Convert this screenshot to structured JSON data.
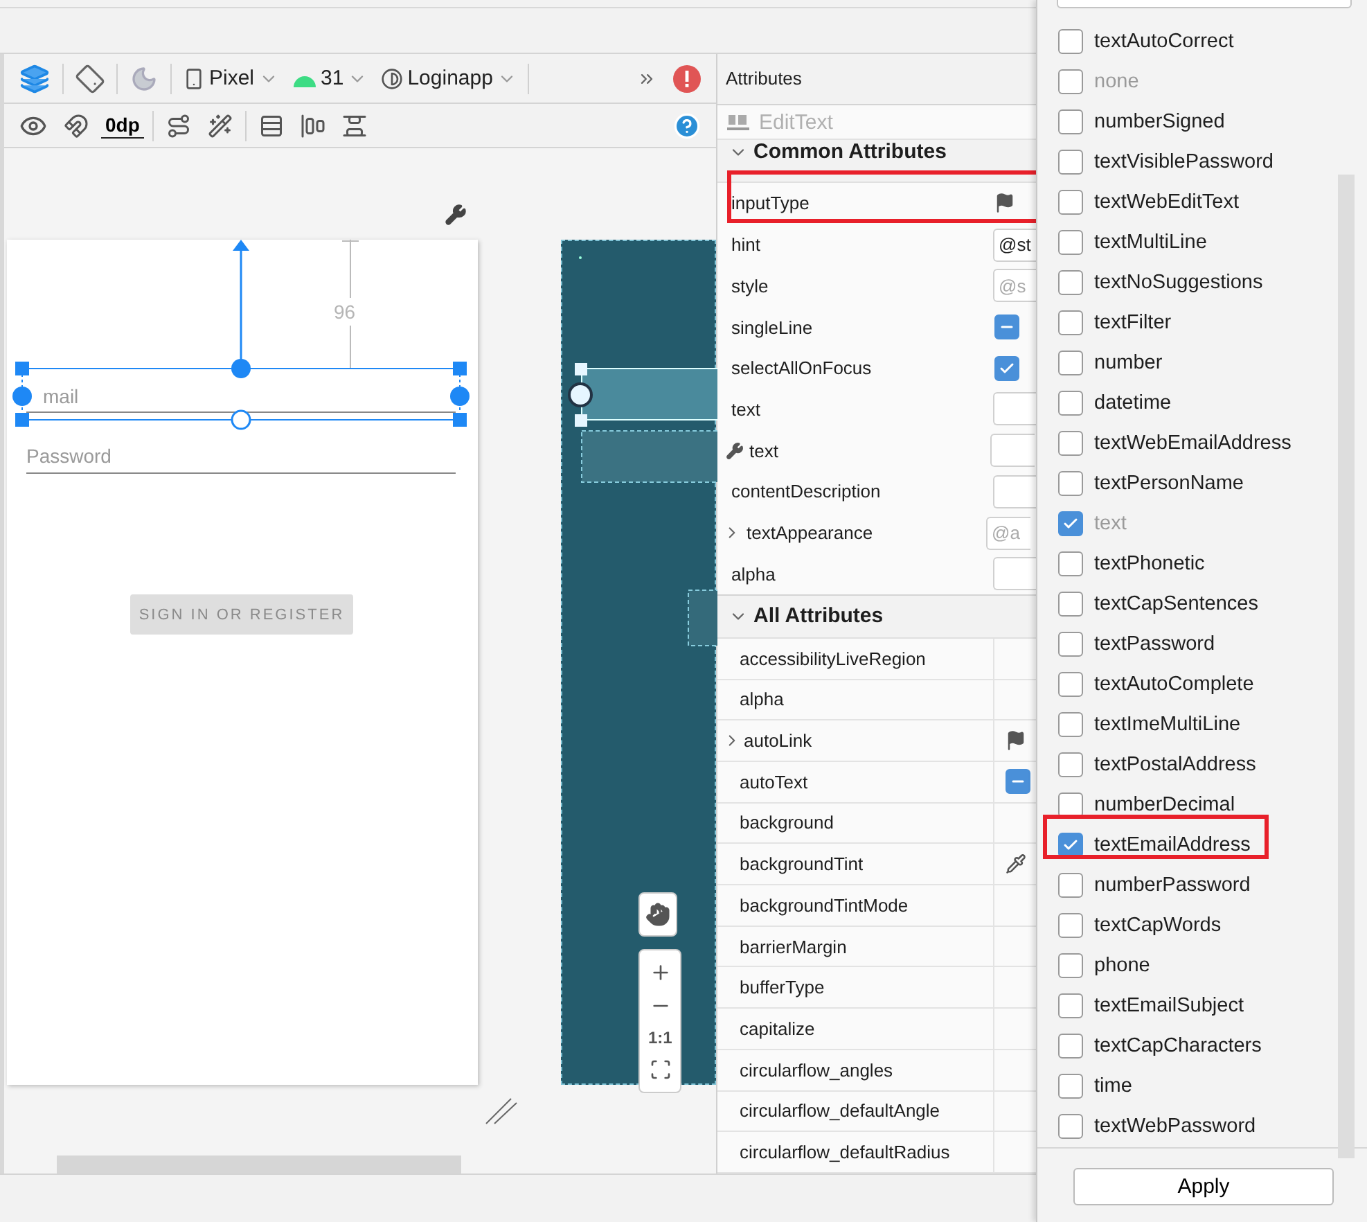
{
  "design_toolbar": {
    "device": "Pixel",
    "api_level": "31",
    "theme": "Loginapp"
  },
  "layout_toolbar": {
    "default_margin": "0dp"
  },
  "blueprint": {
    "dimension": "96",
    "email_hint": "mail",
    "password_hint": "Password",
    "button": "SIGN IN OR REGISTER"
  },
  "zoom_controls": {
    "actual_size": "1:1"
  },
  "attributes": {
    "title": "Attributes",
    "component": "EditText",
    "common_title": "Common Attributes",
    "common": [
      {
        "name": "inputType",
        "kind": "flag"
      },
      {
        "name": "hint",
        "kind": "field",
        "value": "@st"
      },
      {
        "name": "style",
        "kind": "field",
        "placeholder": "@s"
      },
      {
        "name": "singleLine",
        "kind": "checkbox",
        "indeterminate": true
      },
      {
        "name": "selectAllOnFocus",
        "kind": "checkbox",
        "checked": true
      },
      {
        "name": "text",
        "kind": "field"
      },
      {
        "name": "text",
        "kind": "field",
        "design_time": true
      },
      {
        "name": "contentDescription",
        "kind": "field"
      },
      {
        "name": "textAppearance",
        "kind": "field",
        "placeholder": "@a",
        "expandable": true
      },
      {
        "name": "alpha",
        "kind": "field"
      }
    ],
    "all_title": "All Attributes",
    "all": [
      {
        "name": "accessibilityLiveRegion",
        "kind": "none"
      },
      {
        "name": "alpha",
        "kind": "none"
      },
      {
        "name": "autoLink",
        "kind": "flag",
        "expandable": true
      },
      {
        "name": "autoText",
        "kind": "checkbox",
        "indeterminate": true
      },
      {
        "name": "background",
        "kind": "none"
      },
      {
        "name": "backgroundTint",
        "kind": "color"
      },
      {
        "name": "backgroundTintMode",
        "kind": "none"
      },
      {
        "name": "barrierMargin",
        "kind": "none"
      },
      {
        "name": "bufferType",
        "kind": "none"
      },
      {
        "name": "capitalize",
        "kind": "none"
      },
      {
        "name": "circularflow_angles",
        "kind": "none"
      },
      {
        "name": "circularflow_defaultAngle",
        "kind": "none"
      },
      {
        "name": "circularflow_defaultRadius",
        "kind": "none"
      }
    ]
  },
  "input_type_popup": {
    "options": [
      {
        "label": "textAutoCorrect",
        "checked": false,
        "disabled": false
      },
      {
        "label": "none",
        "checked": false,
        "disabled": true
      },
      {
        "label": "numberSigned",
        "checked": false,
        "disabled": false
      },
      {
        "label": "textVisiblePassword",
        "checked": false,
        "disabled": false
      },
      {
        "label": "textWebEditText",
        "checked": false,
        "disabled": false
      },
      {
        "label": "textMultiLine",
        "checked": false,
        "disabled": false
      },
      {
        "label": "textNoSuggestions",
        "checked": false,
        "disabled": false
      },
      {
        "label": "textFilter",
        "checked": false,
        "disabled": false
      },
      {
        "label": "number",
        "checked": false,
        "disabled": false
      },
      {
        "label": "datetime",
        "checked": false,
        "disabled": false
      },
      {
        "label": "textWebEmailAddress",
        "checked": false,
        "disabled": false
      },
      {
        "label": "textPersonName",
        "checked": false,
        "disabled": false
      },
      {
        "label": "text",
        "checked": true,
        "disabled": true
      },
      {
        "label": "textPhonetic",
        "checked": false,
        "disabled": false
      },
      {
        "label": "textCapSentences",
        "checked": false,
        "disabled": false
      },
      {
        "label": "textPassword",
        "checked": false,
        "disabled": false
      },
      {
        "label": "textAutoComplete",
        "checked": false,
        "disabled": false
      },
      {
        "label": "textImeMultiLine",
        "checked": false,
        "disabled": false
      },
      {
        "label": "textPostalAddress",
        "checked": false,
        "disabled": false
      },
      {
        "label": "numberDecimal",
        "checked": false,
        "disabled": false
      },
      {
        "label": "textEmailAddress",
        "checked": true,
        "disabled": false
      },
      {
        "label": "numberPassword",
        "checked": false,
        "disabled": false
      },
      {
        "label": "textCapWords",
        "checked": false,
        "disabled": false
      },
      {
        "label": "phone",
        "checked": false,
        "disabled": false
      },
      {
        "label": "textEmailSubject",
        "checked": false,
        "disabled": false
      },
      {
        "label": "textCapCharacters",
        "checked": false,
        "disabled": false
      },
      {
        "label": "time",
        "checked": false,
        "disabled": false
      },
      {
        "label": "textWebPassword",
        "checked": false,
        "disabled": false
      }
    ],
    "apply": "Apply"
  }
}
